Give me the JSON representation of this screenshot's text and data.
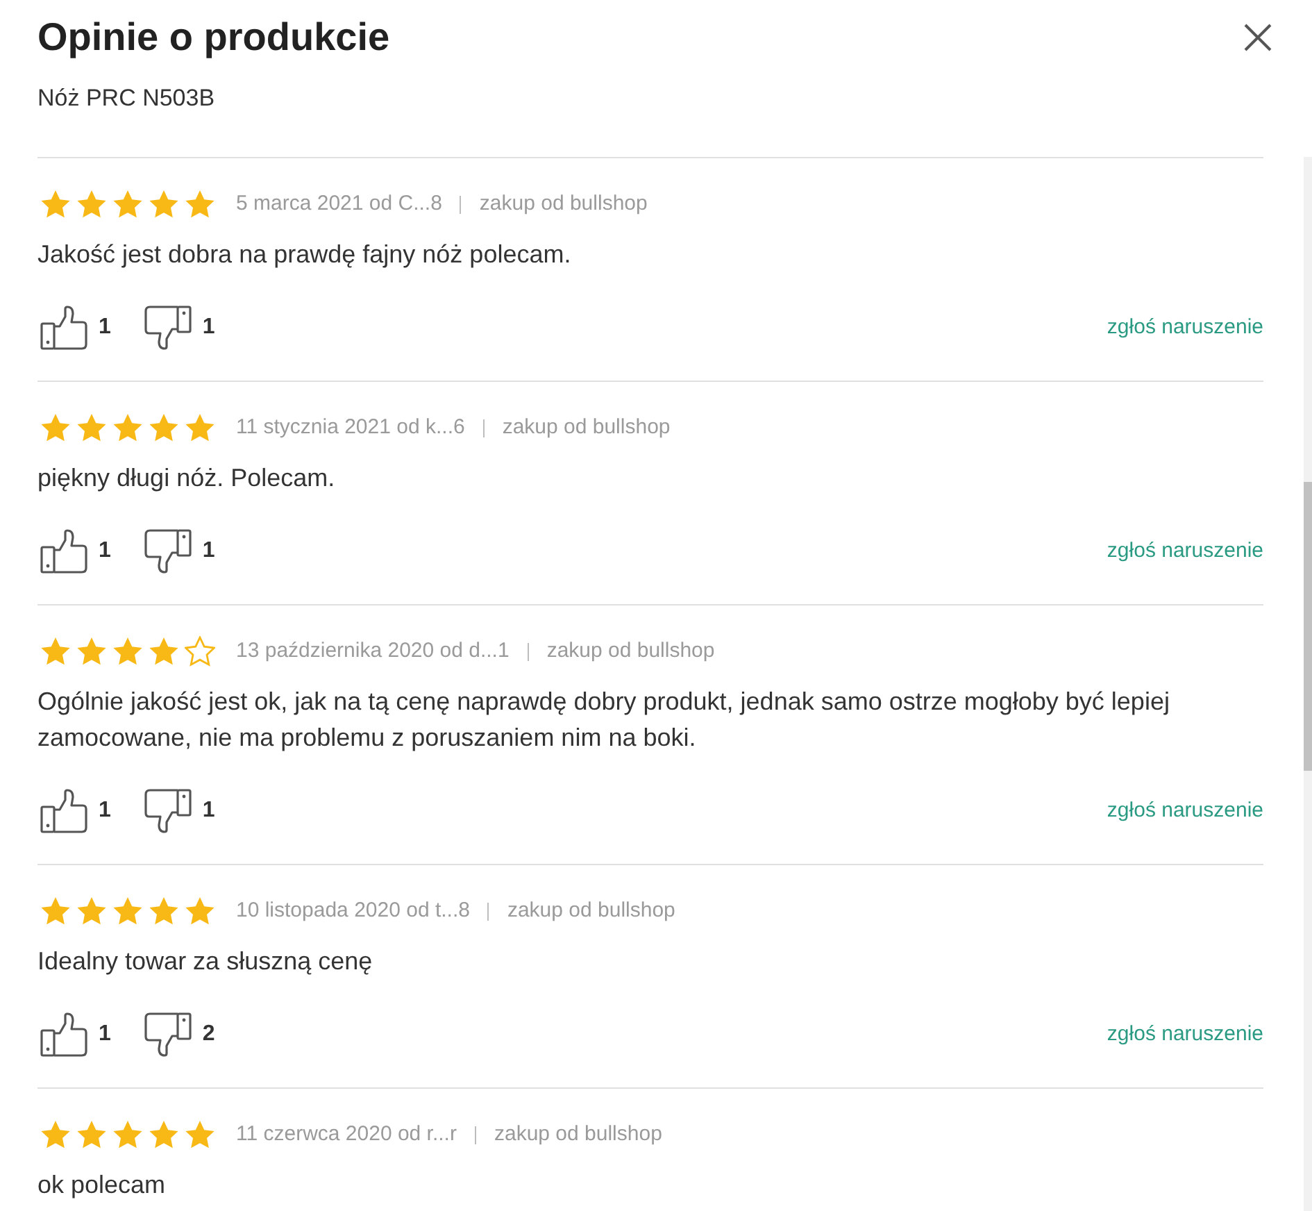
{
  "dialog": {
    "title": "Opinie o produkcie",
    "subtitle": "Nóż PRC N503B"
  },
  "reviews": [
    {
      "stars": 5,
      "date_author": "5 marca 2021 od C...8",
      "source": "zakup od bullshop",
      "text": "Jakość jest dobra na prawdę fajny nóż polecam.",
      "votes": {
        "up": "1",
        "down": "1"
      },
      "report_link": "zgłoś naruszenie"
    },
    {
      "stars": 5,
      "date_author": "11 stycznia 2021 od k...6",
      "source": "zakup od bullshop",
      "text": "piękny długi nóż. Polecam.",
      "votes": {
        "up": "1",
        "down": "1"
      },
      "report_link": "zgłoś naruszenie"
    },
    {
      "stars": 4,
      "date_author": "13 października 2020 od d...1",
      "source": "zakup od bullshop",
      "text": "Ogólnie jakość jest ok, jak na tą cenę naprawdę dobry produkt, jednak samo ostrze mogłoby być lepiej zamocowane, nie ma problemu z poruszaniem nim na boki.",
      "votes": {
        "up": "1",
        "down": "1"
      },
      "report_link": "zgłoś naruszenie"
    },
    {
      "stars": 5,
      "date_author": "10 listopada 2020 od t...8",
      "source": "zakup od bullshop",
      "text": "Idealny towar za słuszną cenę",
      "votes": {
        "up": "1",
        "down": "2"
      },
      "report_link": "zgłoś naruszenie"
    },
    {
      "stars": 5,
      "date_author": "11 czerwca 2020 od r...r",
      "source": "zakup od bullshop",
      "text": "ok polecam"
    }
  ]
}
